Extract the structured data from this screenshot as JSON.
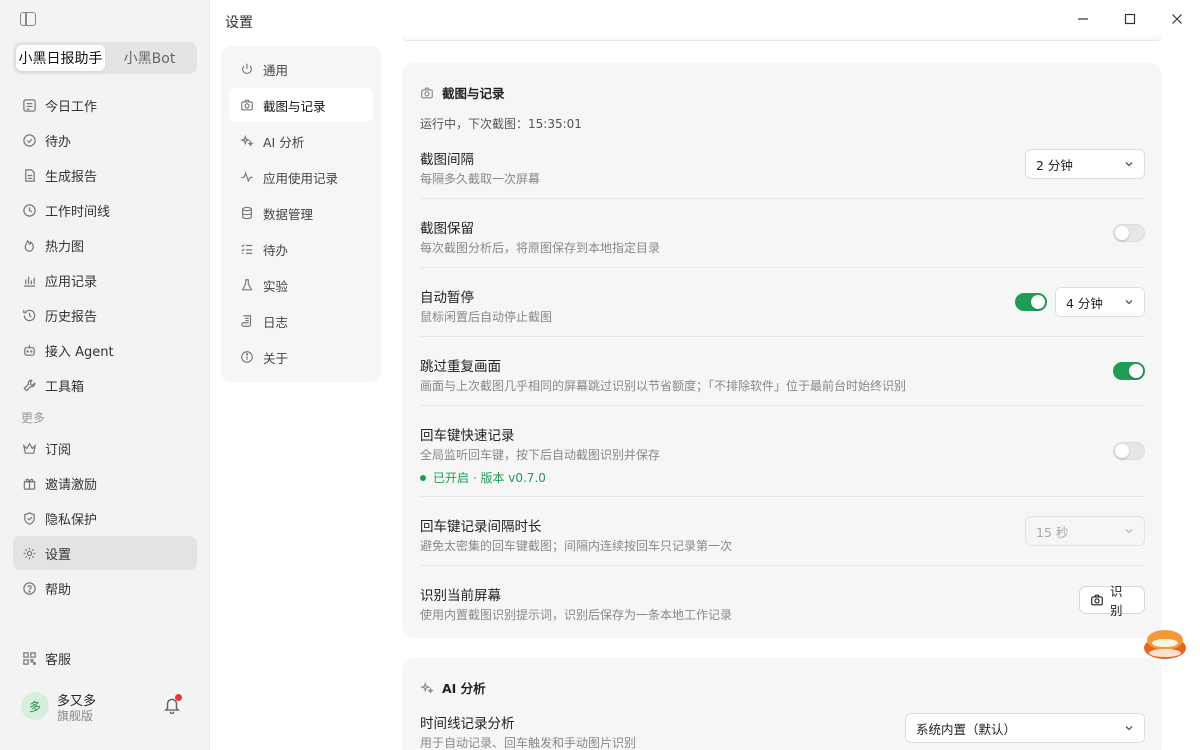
{
  "app": {
    "window_title": "设置"
  },
  "mode_switch": {
    "options": [
      "小黑日报助手",
      "小黑Bot"
    ],
    "active": 0
  },
  "sidebar": {
    "items": [
      {
        "label": "今日工作",
        "icon": "briefcase-icon"
      },
      {
        "label": "待办",
        "icon": "check-circle-icon"
      },
      {
        "label": "生成报告",
        "icon": "document-icon"
      },
      {
        "label": "工作时间线",
        "icon": "clock-icon"
      },
      {
        "label": "热力图",
        "icon": "flame-icon"
      },
      {
        "label": "应用记录",
        "icon": "bar-chart-icon"
      },
      {
        "label": "历史报告",
        "icon": "history-icon"
      },
      {
        "label": "接入 Agent",
        "icon": "robot-icon"
      },
      {
        "label": "工具箱",
        "icon": "wrench-icon"
      }
    ],
    "section_more": "更多",
    "more_items": [
      {
        "label": "订阅",
        "icon": "crown-icon"
      },
      {
        "label": "邀请激励",
        "icon": "gift-icon"
      },
      {
        "label": "隐私保护",
        "icon": "shield-icon"
      },
      {
        "label": "设置",
        "icon": "gear-icon",
        "active": true
      },
      {
        "label": "帮助",
        "icon": "help-icon"
      }
    ],
    "service": {
      "label": "客服",
      "icon": "qr-icon"
    }
  },
  "user": {
    "avatar_text": "多",
    "name": "多又多",
    "plan": "旗舰版",
    "has_notification": true
  },
  "settings_nav": [
    {
      "label": "通用",
      "icon": "power-icon"
    },
    {
      "label": "截图与记录",
      "icon": "camera-icon",
      "active": true
    },
    {
      "label": "AI 分析",
      "icon": "sparkle-icon"
    },
    {
      "label": "应用使用记录",
      "icon": "activity-icon"
    },
    {
      "label": "数据管理",
      "icon": "database-icon"
    },
    {
      "label": "待办",
      "icon": "list-check-icon"
    },
    {
      "label": "实验",
      "icon": "flask-icon"
    },
    {
      "label": "日志",
      "icon": "scroll-icon"
    },
    {
      "label": "关于",
      "icon": "info-icon"
    }
  ],
  "capture_card": {
    "title": "截图与记录",
    "status": "运行中，下次截图：15:35:01",
    "interval": {
      "title": "截图间隔",
      "desc": "每隔多久截取一次屏幕",
      "value": "2 分钟"
    },
    "keep": {
      "title": "截图保留",
      "desc": "每次截图分析后，将原图保存到本地指定目录",
      "enabled": false
    },
    "auto_pause": {
      "title": "自动暂停",
      "desc": "鼠标闲置后自动停止截图",
      "enabled": true,
      "value": "4 分钟"
    },
    "skip_duplicate": {
      "title": "跳过重复画面",
      "desc": "画面与上次截图几乎相同的屏幕跳过识别以节省额度；「不排除软件」位于最前台时始终识别",
      "enabled": true
    },
    "enter_record": {
      "title": "回车键快速记录",
      "desc": "全局监听回车键，按下后自动截图识别并保存",
      "status": "已开启 · 版本 v0.7.0",
      "enabled": false
    },
    "enter_interval": {
      "title": "回车键记录间隔时长",
      "desc": "避免太密集的回车键截图；间隔内连续按回车只记录第一次",
      "value": "15 秒"
    },
    "recognize": {
      "title": "识别当前屏幕",
      "desc": "使用内置截图识别提示词，识别后保存为一条本地工作记录",
      "button": "识别"
    }
  },
  "ai_card": {
    "title": "AI 分析",
    "timeline": {
      "title": "时间线记录分析",
      "desc": "用于自动记录、回车触发和手动图片识别",
      "value": "系统内置（默认）"
    }
  },
  "colors": {
    "accent_green": "#1f9d55",
    "notification_red": "#e53935"
  }
}
